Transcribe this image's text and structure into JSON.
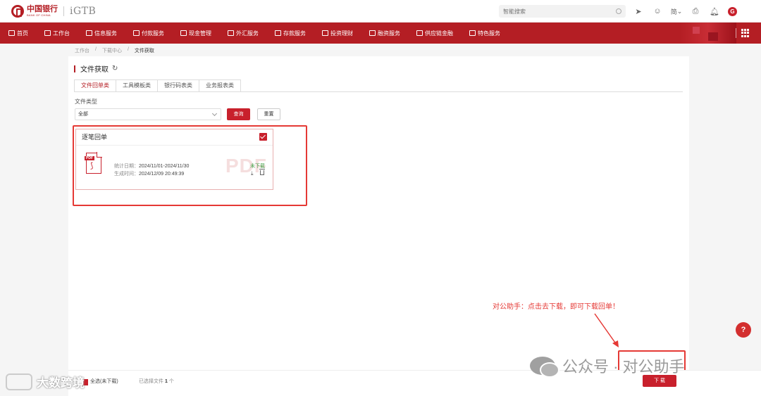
{
  "header": {
    "bank_name_cn": "中国银行",
    "bank_name_en": "BANK OF CHINA",
    "product_logo": "iGTB",
    "search_placeholder": "智能搜索",
    "language": "简",
    "avatar_letter": "G"
  },
  "nav": {
    "items": [
      {
        "label": "首页",
        "icon": "home-icon"
      },
      {
        "label": "工作台",
        "icon": "workbench-icon"
      },
      {
        "label": "信息服务",
        "icon": "info-icon"
      },
      {
        "label": "付款服务",
        "icon": "payment-icon"
      },
      {
        "label": "现金管理",
        "icon": "cash-icon"
      },
      {
        "label": "外汇服务",
        "icon": "forex-icon"
      },
      {
        "label": "存款服务",
        "icon": "deposit-icon"
      },
      {
        "label": "投资理财",
        "icon": "invest-icon"
      },
      {
        "label": "融资服务",
        "icon": "financing-icon"
      },
      {
        "label": "供应链金融",
        "icon": "supply-chain-icon"
      },
      {
        "label": "特色服务",
        "icon": "special-icon"
      }
    ]
  },
  "breadcrumb": [
    "工作台",
    "/",
    "下载中心",
    "/",
    "文件获取"
  ],
  "page": {
    "title": "文件获取",
    "tabs": [
      "文件回单类",
      "工具模板类",
      "银行码表类",
      "业务报表类"
    ],
    "active_tab": "文件回单类",
    "filter_label": "文件类型",
    "filter_value": "全部",
    "query_label": "查询",
    "reset_label": "重置"
  },
  "file_card": {
    "title": "逐笔回单",
    "pdf_tag": "PDF",
    "watermark": "PDF",
    "stat_date_label": "统计日期：",
    "stat_date_value": "2024/11/01-2024/11/30",
    "gen_time_label": "生成时间：",
    "gen_time_value": "2024/12/09 20:49:39",
    "status": "未下载"
  },
  "annotation": {
    "text": "对公助手：点击去下载，即可下载回单！"
  },
  "footer": {
    "select_all_label": "全选(未下载)",
    "selected_prefix": "已选择文件",
    "selected_count": "1",
    "selected_suffix": "个",
    "download_label": "下 载"
  },
  "watermarks": {
    "wechat": "公众号 · 对公助手",
    "left": "大数跨境"
  },
  "help_label": "?",
  "colors": {
    "brand_red": "#b41e24",
    "accent_red": "#c8202c",
    "annotation_red": "#e53935",
    "status_green": "#43a047"
  }
}
